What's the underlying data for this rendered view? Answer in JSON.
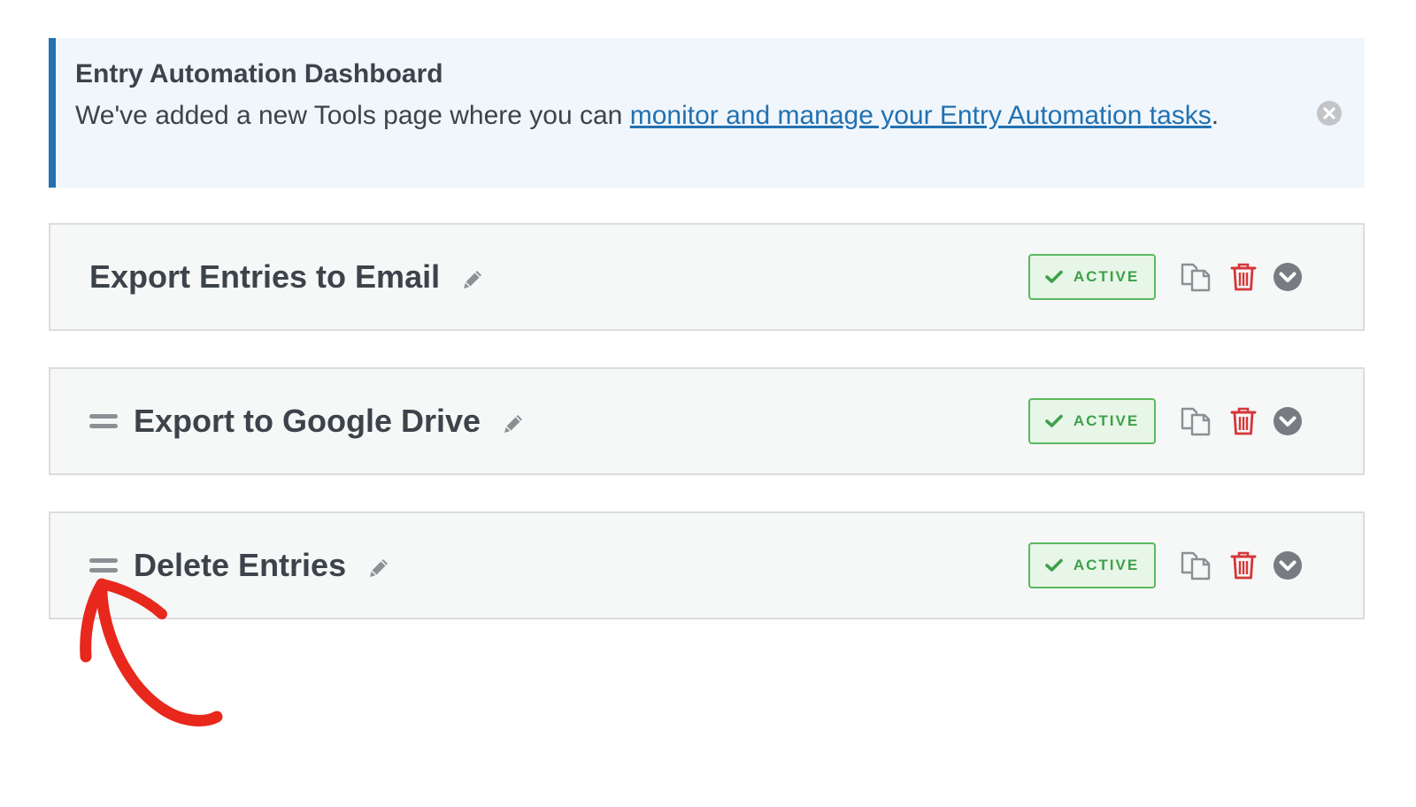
{
  "notice": {
    "title": "Entry Automation Dashboard",
    "body_prefix": "We've added a new Tools page where you can ",
    "link_text_1": "monitor and manage your Entry Automation",
    "link_text_2": "tasks",
    "body_suffix": "."
  },
  "tasks": [
    {
      "title": "Export Entries to Email",
      "status": "ACTIVE",
      "has_handle": false
    },
    {
      "title": "Export to Google Drive",
      "status": "ACTIVE",
      "has_handle": true
    },
    {
      "title": "Delete Entries",
      "status": "ACTIVE",
      "has_handle": true
    }
  ],
  "colors": {
    "notice_border": "#2271b1",
    "link": "#2271b1",
    "active_green": "#3ea04a",
    "trash_red": "#d63638",
    "annotation_red": "#e8281c"
  },
  "icons": [
    "close-circle-icon",
    "drag-handle-icon",
    "pencil-icon",
    "check-icon",
    "duplicate-icon",
    "trash-icon",
    "chevron-down-circle-icon",
    "arrow-annotation"
  ]
}
